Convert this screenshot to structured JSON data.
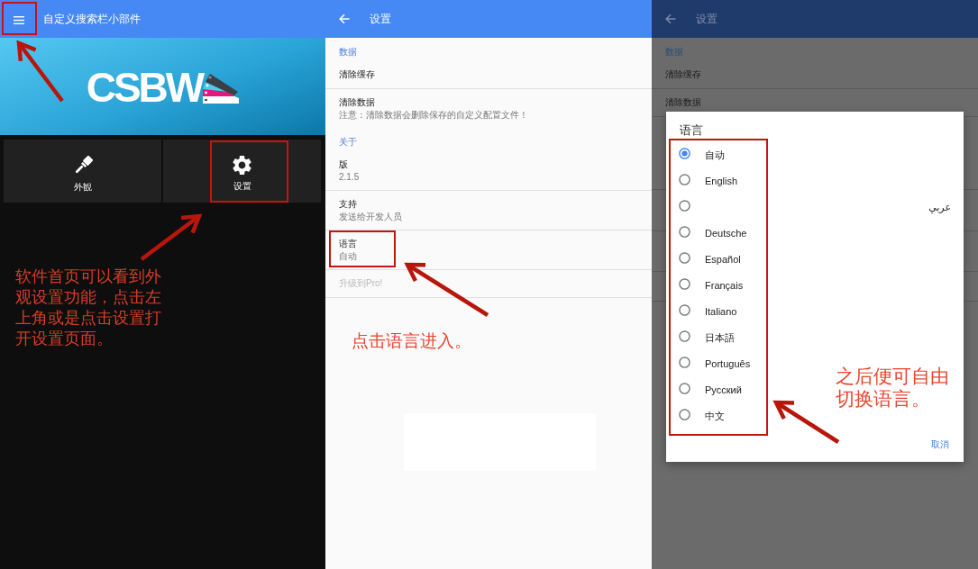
{
  "home_screen": {
    "menu_button": {
      "highlighted": true
    },
    "title": "自定义搜索栏小部件",
    "banner": {
      "logo_text": "CSBW"
    },
    "tiles": [
      {
        "kind": "brush",
        "label": "外観",
        "highlighted": false
      },
      {
        "kind": "gear",
        "label": "设置",
        "highlighted": true
      }
    ],
    "annotation": "软件首页可以看到外观设置功能，点击左上角或是点击设置打开设置页面。"
  },
  "settings_screen": {
    "title": "设置",
    "sections": [
      {
        "header": "数据",
        "items": [
          {
            "title": "清除缓存",
            "disabled": false,
            "highlighted": false
          },
          {
            "title": "清除数据",
            "summary": "注意：清除数据会删除保存的自定义配置文件！",
            "disabled": false,
            "highlighted": false
          }
        ]
      },
      {
        "header": "关于",
        "items": [
          {
            "title": "版",
            "summary": "2.1.5",
            "disabled": false,
            "highlighted": false
          },
          {
            "title": "支持",
            "summary": "发送给开发人员",
            "disabled": false,
            "highlighted": false
          },
          {
            "title": "语言",
            "summary": "自动",
            "disabled": false,
            "highlighted": true
          },
          {
            "title": "升级到Pro!",
            "disabled": true,
            "highlighted": false
          }
        ]
      }
    ],
    "annotation": "点击语言进入。"
  },
  "language_screen": {
    "background": {
      "title": "设置",
      "sections": [
        {
          "header": "数据",
          "items": [
            {
              "title": "清除缓存"
            },
            {
              "title": "清除数据"
            }
          ]
        }
      ]
    },
    "dialog": {
      "title": "语言",
      "options_highlighted": true,
      "options": [
        {
          "label": "自动",
          "selected": true
        },
        {
          "label": "English",
          "selected": false
        },
        {
          "label": "عربي",
          "selected": false
        },
        {
          "label": "Deutsche",
          "selected": false
        },
        {
          "label": "Español",
          "selected": false
        },
        {
          "label": "Français",
          "selected": false
        },
        {
          "label": "Italiano",
          "selected": false
        },
        {
          "label": "日本語",
          "selected": false
        },
        {
          "label": "Português",
          "selected": false
        },
        {
          "label": "Русский",
          "selected": false
        },
        {
          "label": "中文",
          "selected": false
        }
      ],
      "cancel_button": "取消"
    },
    "annotation": "之后便可自由切换语言。"
  }
}
